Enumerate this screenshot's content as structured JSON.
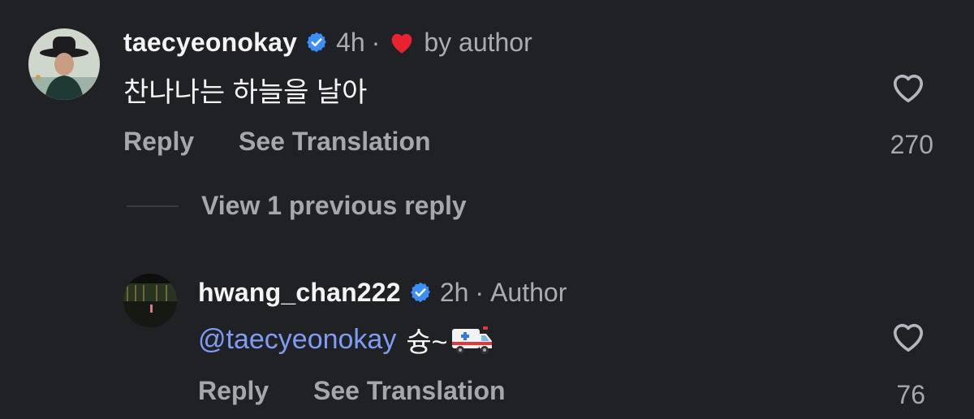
{
  "comment": {
    "username": "taecyeonokay",
    "time": "4h",
    "separator": "·",
    "liked_label": "by author",
    "text": "찬나나는 하늘을 날아",
    "reply_label": "Reply",
    "translate_label": "See Translation",
    "like_count": "270"
  },
  "view_replies_label": "View 1 previous reply",
  "reply": {
    "username": "hwang_chan222",
    "time": "2h",
    "separator": "·",
    "author_tag": "Author",
    "mention": "@taecyeonokay",
    "text": "슝~",
    "reply_label": "Reply",
    "translate_label": "See Translation",
    "like_count": "76"
  },
  "colors": {
    "background": "#202125",
    "verified": "#3b8ff5",
    "heart_filled": "#e8232f",
    "mention": "#7f9cf5",
    "secondary_text": "#a4a8ae"
  }
}
